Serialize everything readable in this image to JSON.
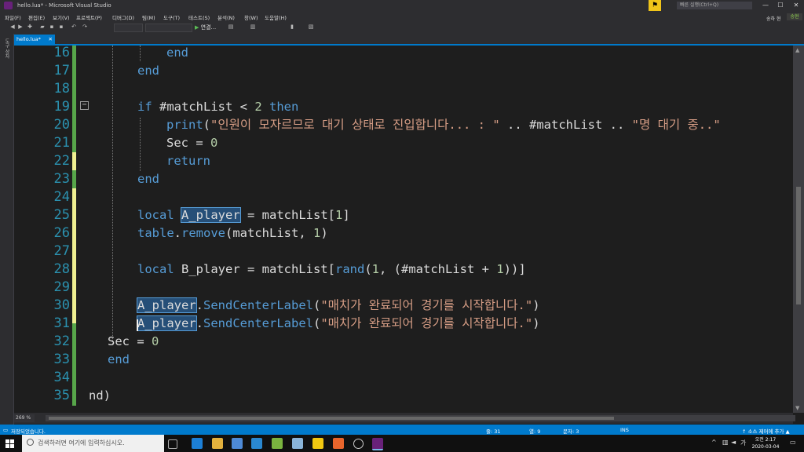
{
  "window": {
    "title": "hello.lua* - Microsoft Visual Studio",
    "search_placeholder": "빠른 실행(Ctrl+Q)",
    "minimize": "—",
    "maximize": "☐",
    "close": "✕"
  },
  "menu": {
    "items": [
      "파일(F)",
      "편집(E)",
      "보기(V)",
      "프로젝트(P)",
      "디버그(D)",
      "팀(M)",
      "도구(T)",
      "테스트(S)",
      "분석(N)",
      "창(W)",
      "도움말(H)"
    ],
    "user": "송하 현",
    "user_badge": "송현"
  },
  "toolbar": {
    "run_label": "연결...",
    "run_icon": "▶"
  },
  "sidebar": {
    "vertical_label": "도구 상자"
  },
  "tab": {
    "label": "hello.lua*",
    "close": "✕"
  },
  "editor": {
    "line_numbers": [
      "16",
      "17",
      "18",
      "19",
      "20",
      "21",
      "22",
      "23",
      "24",
      "25",
      "26",
      "27",
      "28",
      "29",
      "30",
      "31",
      "32",
      "33",
      "34",
      "35"
    ],
    "fold_glyph": "−",
    "zoom": "269 %"
  },
  "status": {
    "message": "저장되었습니다.",
    "line": "줄: 31",
    "col": "열: 9",
    "char": "문자: 3",
    "mode": "INS",
    "source_control": "↑ 소스 제어에 추가 ▲"
  },
  "taskbar": {
    "search_text": "검색하려면 여기에 입력하십시오.",
    "time": "오전 2:17",
    "date": "2020-03-04",
    "ime": "가"
  },
  "colors": {
    "accent": "#007acc",
    "keyword": "#569cd6",
    "string": "#d69d85",
    "number": "#b5cea8",
    "line_number": "#2b91af"
  }
}
